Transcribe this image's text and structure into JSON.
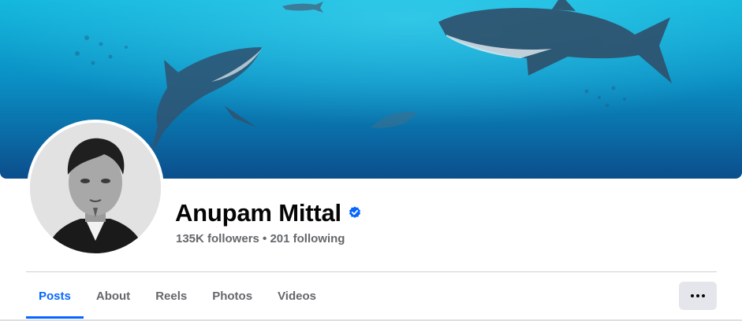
{
  "profile": {
    "name": "Anupam Mittal",
    "stats": "135K followers • 201 following",
    "verified": true
  },
  "cover": {
    "description_icon": "cover-photo"
  },
  "tabs": [
    {
      "label": "Posts",
      "active": true
    },
    {
      "label": "About",
      "active": false
    },
    {
      "label": "Reels",
      "active": false
    },
    {
      "label": "Photos",
      "active": false
    },
    {
      "label": "Videos",
      "active": false
    }
  ],
  "more_button": {
    "icon": "more-dots-icon"
  },
  "colors": {
    "accent": "#0866ff",
    "text_primary": "#050505",
    "text_secondary": "#65676b",
    "button_bg": "#e4e6eb"
  }
}
